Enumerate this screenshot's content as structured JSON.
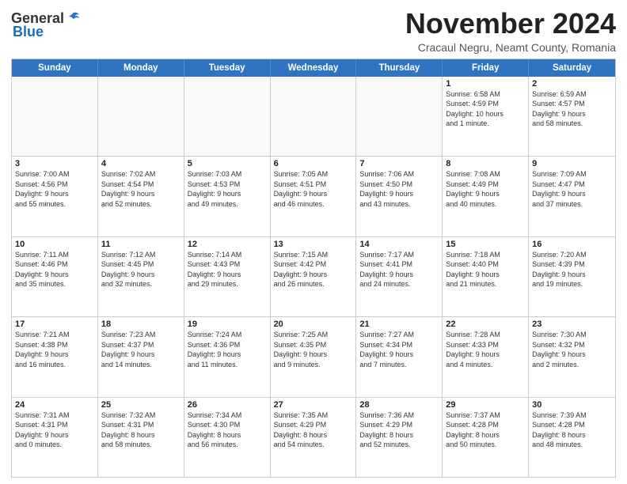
{
  "header": {
    "logo_general": "General",
    "logo_blue": "Blue",
    "month_title": "November 2024",
    "subtitle": "Cracaul Negru, Neamt County, Romania"
  },
  "calendar": {
    "weekdays": [
      "Sunday",
      "Monday",
      "Tuesday",
      "Wednesday",
      "Thursday",
      "Friday",
      "Saturday"
    ],
    "rows": [
      [
        {
          "day": "",
          "info": "",
          "empty": true
        },
        {
          "day": "",
          "info": "",
          "empty": true
        },
        {
          "day": "",
          "info": "",
          "empty": true
        },
        {
          "day": "",
          "info": "",
          "empty": true
        },
        {
          "day": "",
          "info": "",
          "empty": true
        },
        {
          "day": "1",
          "info": "Sunrise: 6:58 AM\nSunset: 4:59 PM\nDaylight: 10 hours\nand 1 minute.",
          "empty": false
        },
        {
          "day": "2",
          "info": "Sunrise: 6:59 AM\nSunset: 4:57 PM\nDaylight: 9 hours\nand 58 minutes.",
          "empty": false
        }
      ],
      [
        {
          "day": "3",
          "info": "Sunrise: 7:00 AM\nSunset: 4:56 PM\nDaylight: 9 hours\nand 55 minutes.",
          "empty": false
        },
        {
          "day": "4",
          "info": "Sunrise: 7:02 AM\nSunset: 4:54 PM\nDaylight: 9 hours\nand 52 minutes.",
          "empty": false
        },
        {
          "day": "5",
          "info": "Sunrise: 7:03 AM\nSunset: 4:53 PM\nDaylight: 9 hours\nand 49 minutes.",
          "empty": false
        },
        {
          "day": "6",
          "info": "Sunrise: 7:05 AM\nSunset: 4:51 PM\nDaylight: 9 hours\nand 46 minutes.",
          "empty": false
        },
        {
          "day": "7",
          "info": "Sunrise: 7:06 AM\nSunset: 4:50 PM\nDaylight: 9 hours\nand 43 minutes.",
          "empty": false
        },
        {
          "day": "8",
          "info": "Sunrise: 7:08 AM\nSunset: 4:49 PM\nDaylight: 9 hours\nand 40 minutes.",
          "empty": false
        },
        {
          "day": "9",
          "info": "Sunrise: 7:09 AM\nSunset: 4:47 PM\nDaylight: 9 hours\nand 37 minutes.",
          "empty": false
        }
      ],
      [
        {
          "day": "10",
          "info": "Sunrise: 7:11 AM\nSunset: 4:46 PM\nDaylight: 9 hours\nand 35 minutes.",
          "empty": false
        },
        {
          "day": "11",
          "info": "Sunrise: 7:12 AM\nSunset: 4:45 PM\nDaylight: 9 hours\nand 32 minutes.",
          "empty": false
        },
        {
          "day": "12",
          "info": "Sunrise: 7:14 AM\nSunset: 4:43 PM\nDaylight: 9 hours\nand 29 minutes.",
          "empty": false
        },
        {
          "day": "13",
          "info": "Sunrise: 7:15 AM\nSunset: 4:42 PM\nDaylight: 9 hours\nand 26 minutes.",
          "empty": false
        },
        {
          "day": "14",
          "info": "Sunrise: 7:17 AM\nSunset: 4:41 PM\nDaylight: 9 hours\nand 24 minutes.",
          "empty": false
        },
        {
          "day": "15",
          "info": "Sunrise: 7:18 AM\nSunset: 4:40 PM\nDaylight: 9 hours\nand 21 minutes.",
          "empty": false
        },
        {
          "day": "16",
          "info": "Sunrise: 7:20 AM\nSunset: 4:39 PM\nDaylight: 9 hours\nand 19 minutes.",
          "empty": false
        }
      ],
      [
        {
          "day": "17",
          "info": "Sunrise: 7:21 AM\nSunset: 4:38 PM\nDaylight: 9 hours\nand 16 minutes.",
          "empty": false
        },
        {
          "day": "18",
          "info": "Sunrise: 7:23 AM\nSunset: 4:37 PM\nDaylight: 9 hours\nand 14 minutes.",
          "empty": false
        },
        {
          "day": "19",
          "info": "Sunrise: 7:24 AM\nSunset: 4:36 PM\nDaylight: 9 hours\nand 11 minutes.",
          "empty": false
        },
        {
          "day": "20",
          "info": "Sunrise: 7:25 AM\nSunset: 4:35 PM\nDaylight: 9 hours\nand 9 minutes.",
          "empty": false
        },
        {
          "day": "21",
          "info": "Sunrise: 7:27 AM\nSunset: 4:34 PM\nDaylight: 9 hours\nand 7 minutes.",
          "empty": false
        },
        {
          "day": "22",
          "info": "Sunrise: 7:28 AM\nSunset: 4:33 PM\nDaylight: 9 hours\nand 4 minutes.",
          "empty": false
        },
        {
          "day": "23",
          "info": "Sunrise: 7:30 AM\nSunset: 4:32 PM\nDaylight: 9 hours\nand 2 minutes.",
          "empty": false
        }
      ],
      [
        {
          "day": "24",
          "info": "Sunrise: 7:31 AM\nSunset: 4:31 PM\nDaylight: 9 hours\nand 0 minutes.",
          "empty": false
        },
        {
          "day": "25",
          "info": "Sunrise: 7:32 AM\nSunset: 4:31 PM\nDaylight: 8 hours\nand 58 minutes.",
          "empty": false
        },
        {
          "day": "26",
          "info": "Sunrise: 7:34 AM\nSunset: 4:30 PM\nDaylight: 8 hours\nand 56 minutes.",
          "empty": false
        },
        {
          "day": "27",
          "info": "Sunrise: 7:35 AM\nSunset: 4:29 PM\nDaylight: 8 hours\nand 54 minutes.",
          "empty": false
        },
        {
          "day": "28",
          "info": "Sunrise: 7:36 AM\nSunset: 4:29 PM\nDaylight: 8 hours\nand 52 minutes.",
          "empty": false
        },
        {
          "day": "29",
          "info": "Sunrise: 7:37 AM\nSunset: 4:28 PM\nDaylight: 8 hours\nand 50 minutes.",
          "empty": false
        },
        {
          "day": "30",
          "info": "Sunrise: 7:39 AM\nSunset: 4:28 PM\nDaylight: 8 hours\nand 48 minutes.",
          "empty": false
        }
      ]
    ]
  }
}
